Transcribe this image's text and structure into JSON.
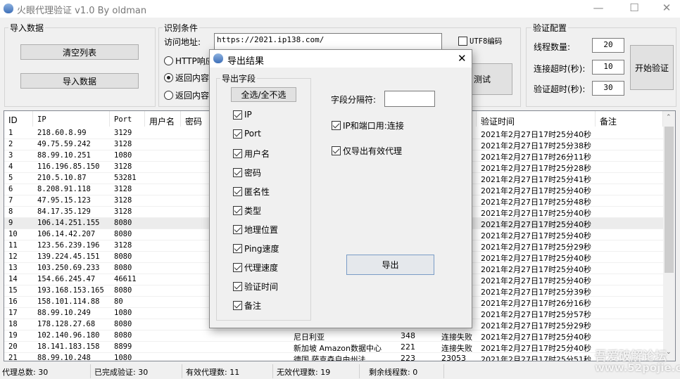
{
  "window": {
    "title": "火眼代理验证 v1.0 By oldman",
    "minimize": "—",
    "maximize": "☐",
    "close": "✕"
  },
  "import_group": {
    "label": "导入数据",
    "clear_button": "清空列表",
    "import_button": "导入数据"
  },
  "detect_group": {
    "label": "识别条件",
    "url_label": "访问地址:",
    "url_value": "https://2021.ip138.com/",
    "utf8_label": "UTF8编码",
    "utf8_checked": false,
    "radios": [
      {
        "label": "HTTP响应",
        "checked": false
      },
      {
        "label": "返回内容",
        "checked": true
      },
      {
        "label": "返回内容",
        "checked": false
      }
    ],
    "test_button": "测试"
  },
  "config_group": {
    "label": "验证配置",
    "threads_label": "线程数量:",
    "threads": "20",
    "conn_timeout_label": "连接超时(秒):",
    "conn_timeout": "10",
    "verify_timeout_label": "验证超时(秒):",
    "verify_timeout": "30",
    "start_button": "开始验证"
  },
  "table": {
    "headers": {
      "id": "ID",
      "ip": "IP",
      "port": "Port",
      "user": "用户名",
      "pass": "密码",
      "time": "验证时间",
      "note": "备注"
    },
    "rows": [
      [
        "1",
        "218.60.8.99",
        "3129",
        "",
        "",
        "",
        "",
        "2021年2月27日17时25分40秒"
      ],
      [
        "2",
        "49.75.59.242",
        "3128",
        "",
        "",
        "",
        "",
        "2021年2月27日17时25分38秒"
      ],
      [
        "3",
        "88.99.10.251",
        "1080",
        "",
        "",
        "",
        "",
        "2021年2月27日17时26分11秒"
      ],
      [
        "4",
        "116.196.85.150",
        "3128",
        "",
        "",
        "",
        "",
        "2021年2月27日17时25分28秒"
      ],
      [
        "5",
        "210.5.10.87",
        "53281",
        "",
        "",
        "",
        "",
        "2021年2月27日17时25分41秒"
      ],
      [
        "6",
        "8.208.91.118",
        "3128",
        "",
        "",
        "",
        "",
        "2021年2月27日17时25分40秒"
      ],
      [
        "7",
        "47.95.15.123",
        "3128",
        "",
        "",
        "",
        "",
        "2021年2月27日17时25分48秒"
      ],
      [
        "8",
        "84.17.35.129",
        "3128",
        "",
        "",
        "",
        "",
        "2021年2月27日17时25分40秒"
      ],
      [
        "9",
        "106.14.251.155",
        "8080",
        "",
        "",
        "",
        "",
        "2021年2月27日17时25分40秒"
      ],
      [
        "10",
        "106.14.42.207",
        "8080",
        "",
        "",
        "",
        "",
        "2021年2月27日17时25分40秒"
      ],
      [
        "11",
        "123.56.239.196",
        "3128",
        "",
        "",
        "",
        "",
        "2021年2月27日17时25分29秒"
      ],
      [
        "12",
        "139.224.45.151",
        "8080",
        "",
        "",
        "",
        "",
        "2021年2月27日17时25分40秒"
      ],
      [
        "13",
        "103.250.69.233",
        "8080",
        "",
        "",
        "",
        "",
        "2021年2月27日17时25分40秒"
      ],
      [
        "14",
        "154.66.245.47",
        "46611",
        "",
        "",
        "",
        "",
        "2021年2月27日17时25分40秒"
      ],
      [
        "15",
        "193.168.153.165",
        "8080",
        "",
        "",
        "",
        "",
        "2021年2月27日17时25分39秒"
      ],
      [
        "16",
        "158.101.114.88",
        "80",
        "",
        "",
        "",
        "",
        "2021年2月27日17时26分16秒"
      ],
      [
        "17",
        "88.99.10.249",
        "1080",
        "",
        "",
        "",
        "",
        "2021年2月27日17时25分57秒"
      ],
      [
        "18",
        "178.128.27.68",
        "8080",
        "",
        "",
        "",
        "",
        "2021年2月27日17时25分29秒"
      ],
      [
        "19",
        "102.140.96.180",
        "8080",
        "尼日利亚",
        "348",
        "连接失败",
        "",
        "2021年2月27日17时25分40秒"
      ],
      [
        "20",
        "18.141.183.158",
        "8899",
        "新加坡 Amazon数据中心",
        "221",
        "连接失败",
        "",
        "2021年2月27日17时25分40秒"
      ],
      [
        "21",
        "88.99.10.248",
        "1080",
        "德国 萨克森自由州法",
        "223",
        "23053",
        "",
        "2021年2月27日17时25分51秒"
      ]
    ],
    "selected_row": 9
  },
  "status": {
    "total": "代理总数: 30",
    "done": "已完成验证: 30",
    "valid": "有效代理数: 11",
    "invalid": "无效代理数: 19",
    "threads_left": "剩余线程数: 0"
  },
  "dialog": {
    "title": "导出结果",
    "close": "✕",
    "fields_group": "导出字段",
    "toggle_all": "全选/全不选",
    "fields": [
      {
        "label": "IP",
        "checked": true
      },
      {
        "label": "Port",
        "checked": true
      },
      {
        "label": "用户名",
        "checked": true
      },
      {
        "label": "密码",
        "checked": true
      },
      {
        "label": "匿名性",
        "checked": true
      },
      {
        "label": "类型",
        "checked": true
      },
      {
        "label": "地理位置",
        "checked": true
      },
      {
        "label": "Ping速度",
        "checked": true
      },
      {
        "label": "代理速度",
        "checked": true
      },
      {
        "label": "验证时间",
        "checked": true
      },
      {
        "label": "备注",
        "checked": true
      }
    ],
    "separator_label": "字段分隔符:",
    "separator_value": "",
    "ip_port_colon": "IP和端口用:连接",
    "ip_port_colon_checked": true,
    "valid_only": "仅导出有效代理",
    "valid_only_checked": true,
    "export_button": "导出"
  },
  "watermark": {
    "line1": "吾爱破解论坛",
    "line2": "www.52pojie.cn"
  }
}
